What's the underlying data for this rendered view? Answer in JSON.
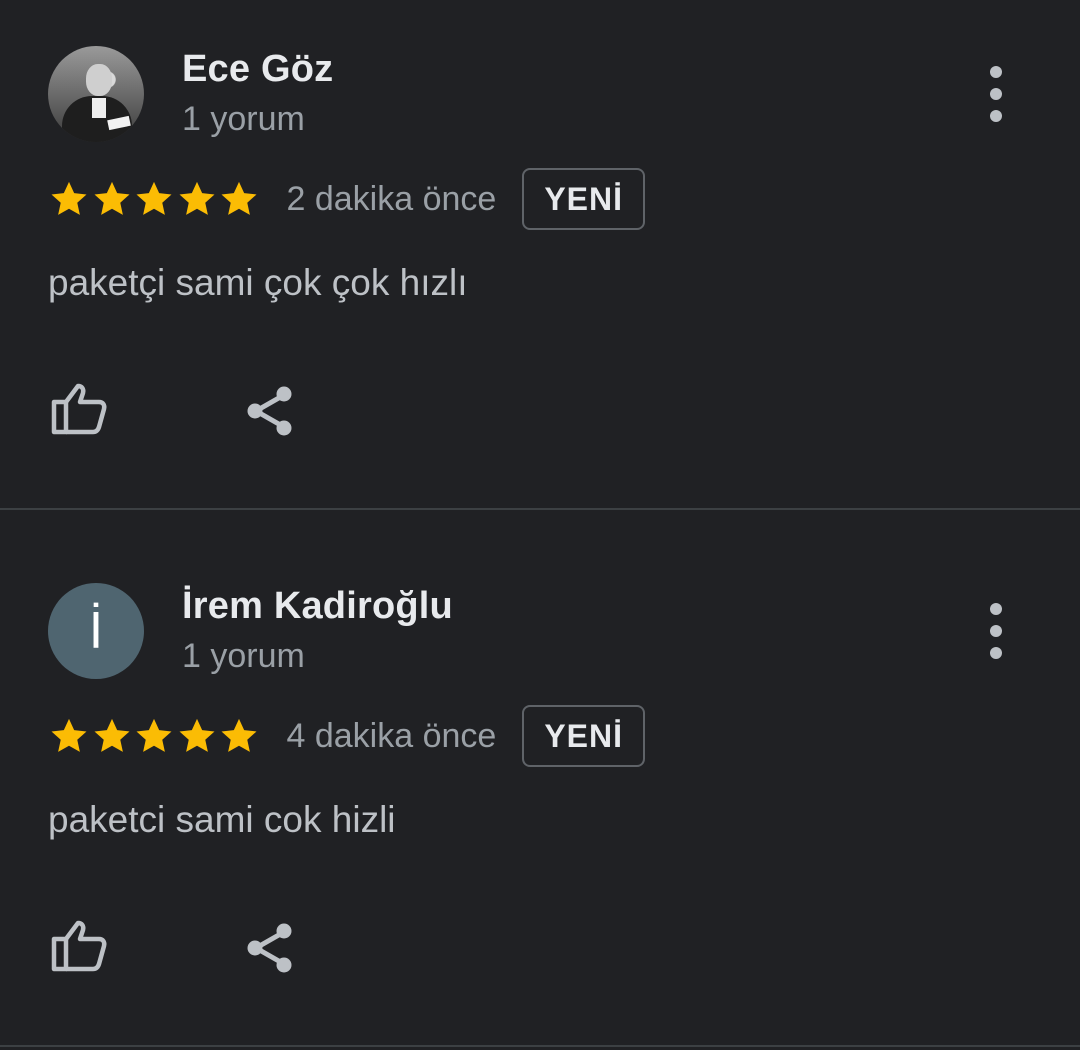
{
  "reviews": [
    {
      "author": "Ece Göz",
      "review_count": "1 yorum",
      "avatar_type": "photo",
      "rating": 5,
      "time": "2 dakika önce",
      "badge": "YENİ",
      "text": "paketçi sami çok çok hızlı"
    },
    {
      "author": "İrem Kadiroğlu",
      "review_count": "1 yorum",
      "avatar_type": "letter",
      "avatar_letter": "İ",
      "avatar_color": "#4f6570",
      "rating": 5,
      "time": "4 dakika önce",
      "badge": "YENİ",
      "text": "paketci sami cok hizli"
    }
  ],
  "icons": {
    "star": "star-icon",
    "like": "thumb-up-outline-icon",
    "share": "share-icon",
    "more": "more-vertical-icon"
  },
  "colors": {
    "background": "#202124",
    "star": "#fbbc04",
    "primary_text": "#e8eaed",
    "secondary_text": "#9aa0a6",
    "divider": "#3c4043"
  }
}
